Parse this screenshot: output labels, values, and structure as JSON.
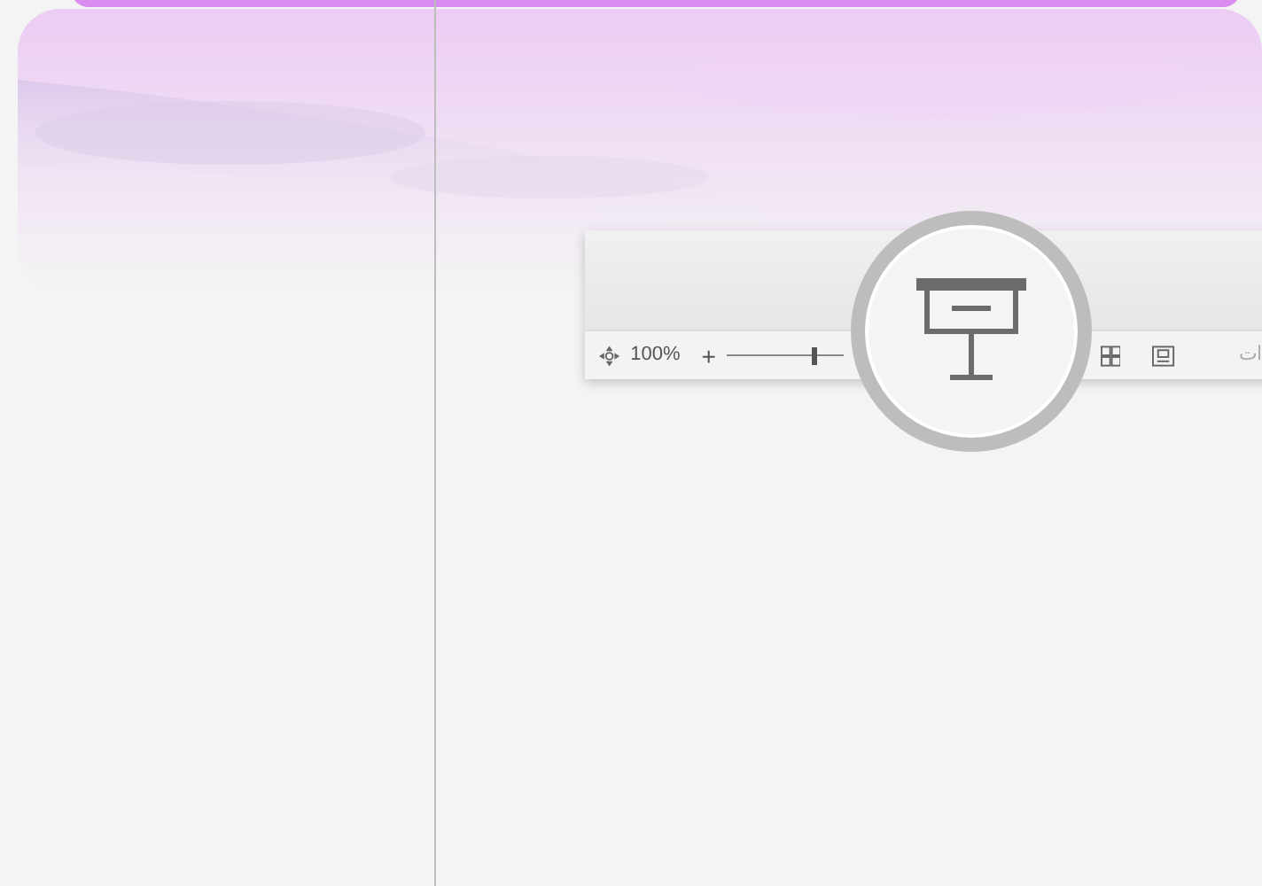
{
  "status_bar": {
    "zoom_value": "100%",
    "zoom_in": "+",
    "zoom_slider": {
      "level": 0.74
    },
    "cut_label": "ات"
  }
}
